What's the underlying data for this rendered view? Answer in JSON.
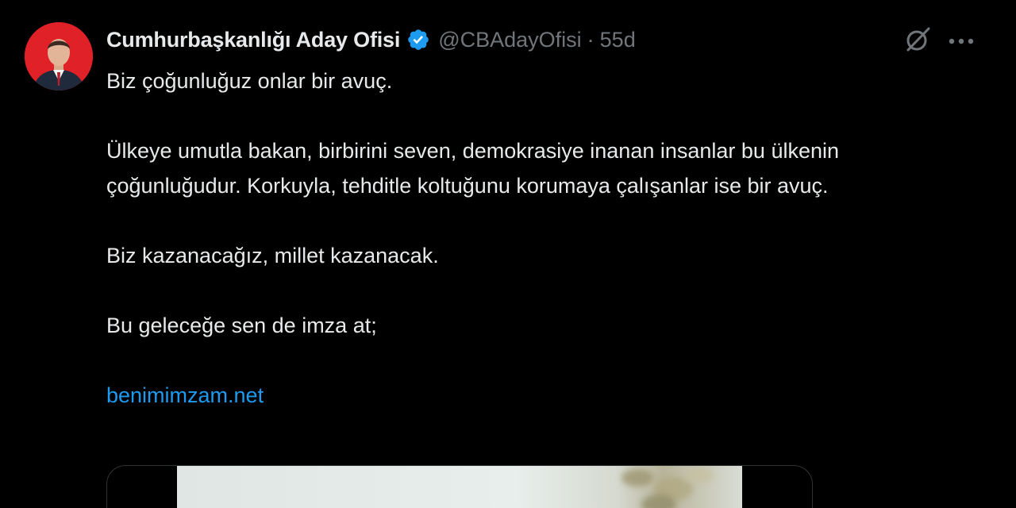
{
  "tweet": {
    "display_name": "Cumhurbaşkanlığı Aday Ofisi",
    "handle": "@CBAdayOfisi",
    "separator": "·",
    "time": "55d",
    "paragraphs": [
      "Biz çoğunluğuz onlar bir avuç.",
      "Ülkeye umutla bakan, birbirini seven, demokrasiye inanan insanlar bu ülkenin çoğunluğudur. Korkuyla, tehditle koltuğunu korumaya çalışanlar ise bir avuç.",
      "Biz kazanacağız, millet kazanacak.",
      "Bu geleceğe sen de imza at;"
    ],
    "link_text": "benimimzam.net"
  },
  "colors": {
    "background": "#000000",
    "text": "#e7e9ea",
    "muted": "#71767b",
    "link": "#1d9bf0",
    "verified": "#1d9bf0",
    "avatar_bg": "#e02128"
  },
  "icons": {
    "verified": "verified-badge-icon",
    "grok": "grok-icon",
    "more": "more-horizontal-icon"
  }
}
